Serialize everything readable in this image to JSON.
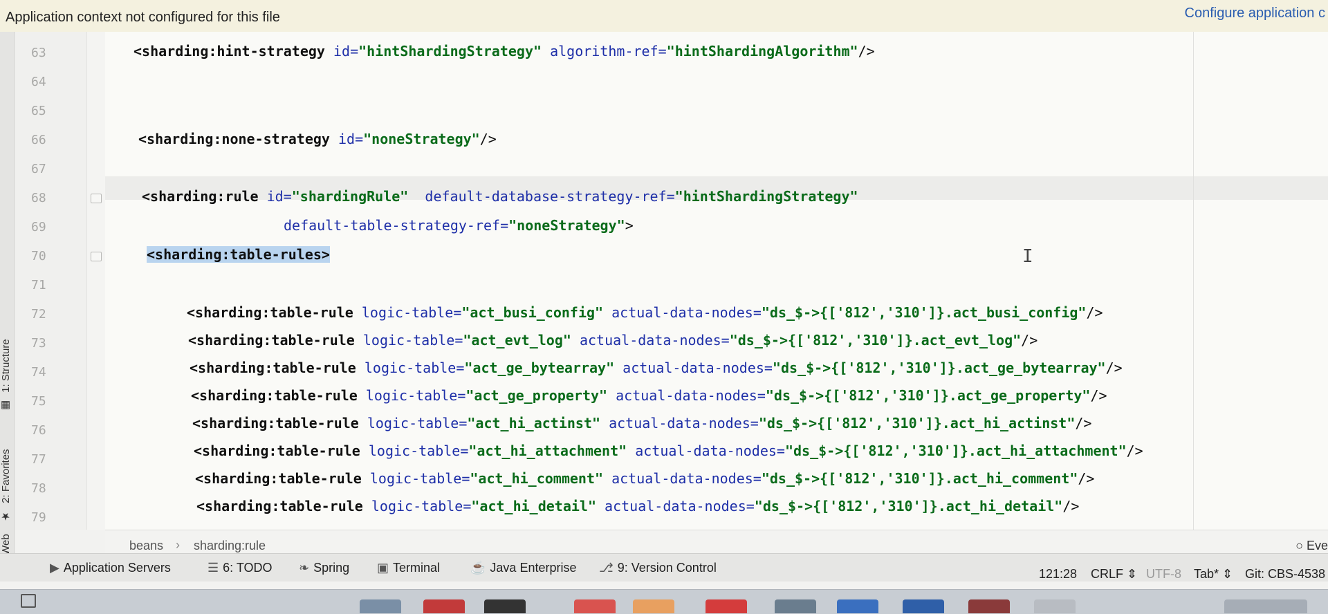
{
  "notification": {
    "text": "Application context not configured for this file",
    "link": "Configure application c"
  },
  "left_tabs": [
    {
      "label": "1: Structure",
      "icon": "structure-icon"
    },
    {
      "label": "2: Favorites",
      "icon": "star-icon"
    },
    {
      "label": "Web",
      "icon": "web-icon"
    }
  ],
  "line_numbers": [
    "63",
    "64",
    "65",
    "66",
    "67",
    "68",
    "69",
    "70",
    "71",
    "72",
    "73",
    "74",
    "75",
    "76",
    "77",
    "78",
    "79"
  ],
  "code": {
    "line63": {
      "tag": "<sharding:hint-strategy",
      "a1": "id=",
      "v1": "\"hintShardingStrategy\"",
      "a2": "algorithm-ref=",
      "v2": "\"hintShardingAlgorithm\"",
      "end": "/>"
    },
    "line66": {
      "tag": "<sharding:none-strategy",
      "a1": "id=",
      "v1": "\"noneStrategy\"",
      "end": "/>"
    },
    "line68": {
      "tag": "<sharding:rule",
      "a1": "id=",
      "v1": "\"shardingRule\"",
      "a2": "default-database-strategy-ref=",
      "v2": "\"hintShardingStrategy\""
    },
    "line69": {
      "a1": "default-table-strategy-ref=",
      "v1": "\"noneStrategy\"",
      "end": ">"
    },
    "line70": {
      "tag": "<sharding:table-rules>"
    },
    "rules": [
      {
        "tag": "<sharding:table-rule",
        "a1": "logic-table=",
        "v1": "\"act_busi_config\"",
        "a2": "actual-data-nodes=",
        "v2": "\"ds_$->{['812','310']}.act_busi_config\"",
        "end": "/>"
      },
      {
        "tag": "<sharding:table-rule",
        "a1": "logic-table=",
        "v1": "\"act_evt_log\"",
        "a2": "actual-data-nodes=",
        "v2": "\"ds_$->{['812','310']}.act_evt_log\"",
        "end": "/>"
      },
      {
        "tag": "<sharding:table-rule",
        "a1": "logic-table=",
        "v1": "\"act_ge_bytearray\"",
        "a2": "actual-data-nodes=",
        "v2": "\"ds_$->{['812','310']}.act_ge_bytearray\"",
        "end": "/>"
      },
      {
        "tag": "<sharding:table-rule",
        "a1": "logic-table=",
        "v1": "\"act_ge_property\"",
        "a2": "actual-data-nodes=",
        "v2": "\"ds_$->{['812','310']}.act_ge_property\"",
        "end": "/>"
      },
      {
        "tag": "<sharding:table-rule",
        "a1": "logic-table=",
        "v1": "\"act_hi_actinst\"",
        "a2": "actual-data-nodes=",
        "v2": "\"ds_$->{['812','310']}.act_hi_actinst\"",
        "end": "/>"
      },
      {
        "tag": "<sharding:table-rule",
        "a1": "logic-table=",
        "v1": "\"act_hi_attachment\"",
        "a2": "actual-data-nodes=",
        "v2": "\"ds_$->{['812','310']}.act_hi_attachment\"",
        "end": "/>"
      },
      {
        "tag": "<sharding:table-rule",
        "a1": "logic-table=",
        "v1": "\"act_hi_comment\"",
        "a2": "actual-data-nodes=",
        "v2": "\"ds_$->{['812','310']}.act_hi_comment\"",
        "end": "/>"
      },
      {
        "tag": "<sharding:table-rule",
        "a1": "logic-table=",
        "v1": "\"act_hi_detail\"",
        "a2": "actual-data-nodes=",
        "v2": "\"ds_$->{['812','310']}.act_hi_detail\"",
        "end": "/>"
      }
    ]
  },
  "breadcrumb": {
    "items": [
      "beans",
      "sharding:rule"
    ],
    "right": "Eve"
  },
  "tool_windows": [
    {
      "label": "Application Servers",
      "icon": "server-icon"
    },
    {
      "label": "6: TODO",
      "icon": "list-icon"
    },
    {
      "label": "Spring",
      "icon": "leaf-icon"
    },
    {
      "label": "Terminal",
      "icon": "terminal-icon"
    },
    {
      "label": "Java Enterprise",
      "icon": "java-enterprise-icon"
    },
    {
      "label": "9: Version Control",
      "icon": "vcs-icon"
    }
  ],
  "status": {
    "position": "121:28",
    "line_sep": "CRLF",
    "encoding": "UTF-8",
    "indent": "Tab*",
    "git": "Git: CBS-4538"
  }
}
